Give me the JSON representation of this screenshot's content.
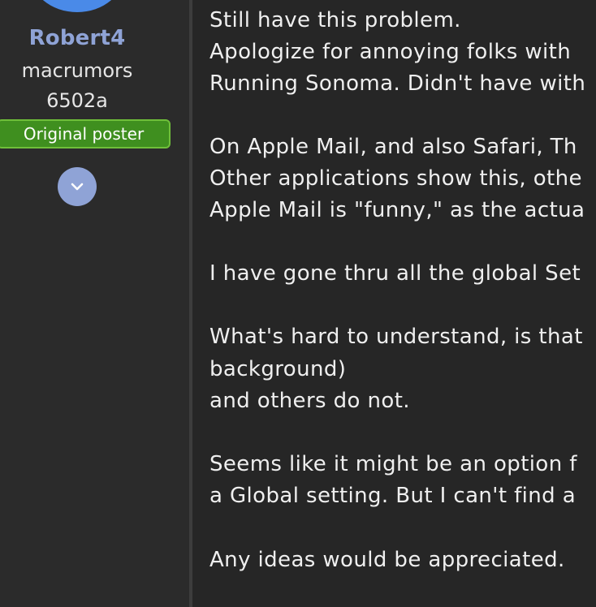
{
  "author": {
    "username": "Robert4",
    "title_line1": "macrumors",
    "title_line2": "6502a",
    "badge": "Original poster",
    "expand_icon": "chevron-down-icon"
  },
  "colors": {
    "page_background": "#262626",
    "sidebar_background": "#2b2b2b",
    "username": "#8fa3d6",
    "avatar": "#4a8ae8",
    "badge_background": "#3f8f1f",
    "badge_border": "#6fbf3a",
    "text": "#efefef"
  },
  "post": {
    "lines": [
      "Still have this problem.",
      "Apologize for annoying folks with",
      "Running Sonoma. Didn't have with",
      "",
      "On Apple Mail, and also Safari, Th",
      "Other applications show this, othe",
      "Apple Mail is \"funny,\" as the actua",
      "",
      "I have gone thru all the global Set",
      "",
      "What's hard to understand, is that",
      "background)",
      "and others do not.",
      "",
      "Seems like it might be an option f",
      "a Global setting. But I can't find a",
      "",
      "Any ideas would be appreciated."
    ]
  }
}
